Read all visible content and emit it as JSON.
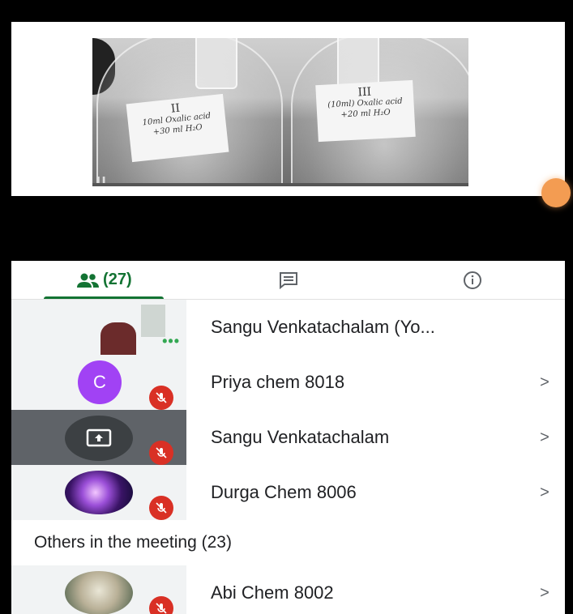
{
  "video": {
    "flask_left_label": {
      "num": "II",
      "line1": "10ml Oxalic acid",
      "line2": "+30 ml H₂O"
    },
    "flask_right_label": {
      "num": "III",
      "line1": "(10ml) Oxalic acid",
      "line2": "+20 ml H₂O"
    }
  },
  "tabs": {
    "people_count": "(27)"
  },
  "participants": [
    {
      "name": "Sangu Venkatachalam (Yo..."
    },
    {
      "name": "Priya chem 8018",
      "avatar_letter": "C",
      "chevron": ">"
    },
    {
      "name": "Sangu Venkatachalam",
      "chevron": ">"
    },
    {
      "name": "Durga Chem 8006",
      "chevron": ">"
    }
  ],
  "others": {
    "heading": "Others in the meeting (23)",
    "items": [
      {
        "name": "Abi Chem 8002",
        "chevron": ">"
      }
    ]
  },
  "colors": {
    "accent": "#137333",
    "mute": "#d93025",
    "avatar_c": "#a142f4"
  },
  "icons": [
    "people-icon",
    "chat-icon",
    "info-icon",
    "present-screen-icon",
    "mic-off-icon",
    "chevron-right-icon",
    "more-dots-icon"
  ]
}
